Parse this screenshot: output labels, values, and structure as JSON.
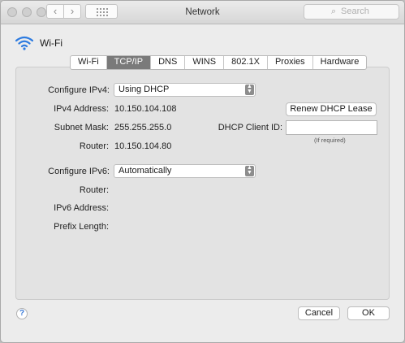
{
  "window": {
    "title": "Network"
  },
  "toolbar": {
    "back_glyph": "‹",
    "forward_glyph": "›",
    "search_placeholder": "Search"
  },
  "header": {
    "title": "Wi-Fi",
    "icon": "wifi-icon"
  },
  "tabs": [
    {
      "label": "Wi-Fi",
      "active": false
    },
    {
      "label": "TCP/IP",
      "active": true
    },
    {
      "label": "DNS",
      "active": false
    },
    {
      "label": "WINS",
      "active": false
    },
    {
      "label": "802.1X",
      "active": false
    },
    {
      "label": "Proxies",
      "active": false
    },
    {
      "label": "Hardware",
      "active": false
    }
  ],
  "ipv4": {
    "configure_label": "Configure IPv4:",
    "configure_value": "Using DHCP",
    "address_label": "IPv4 Address:",
    "address_value": "10.150.104.108",
    "subnet_label": "Subnet Mask:",
    "subnet_value": "255.255.255.0",
    "router_label": "Router:",
    "router_value": "10.150.104.80",
    "renew_button": "Renew DHCP Lease",
    "client_id_label": "DHCP Client ID:",
    "client_id_value": "",
    "client_id_hint": "(If required)"
  },
  "ipv6": {
    "configure_label": "Configure IPv6:",
    "configure_value": "Automatically",
    "router_label": "Router:",
    "address_label": "IPv6 Address:",
    "prefix_label": "Prefix Length:"
  },
  "footer": {
    "help_label": "?",
    "cancel_label": "Cancel",
    "ok_label": "OK"
  },
  "colors": {
    "active_tab": "#7a7a7a",
    "help_accent": "#3b7bd8"
  }
}
